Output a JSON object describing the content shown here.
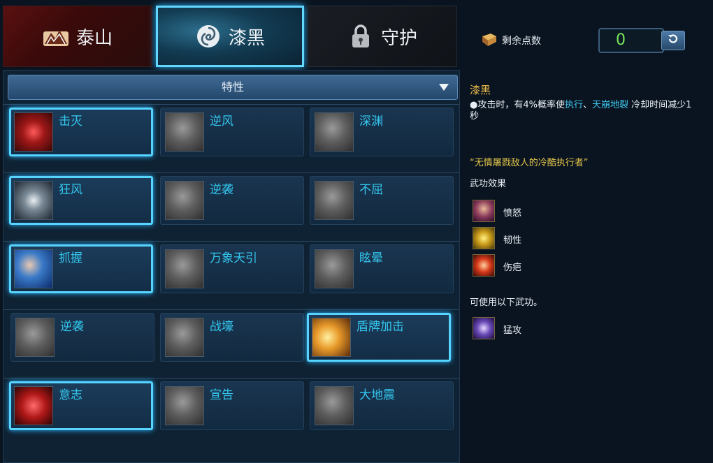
{
  "tabs": [
    {
      "label": "泰山",
      "icon": "mountain-icon"
    },
    {
      "label": "漆黑",
      "icon": "swirl-icon",
      "active": true
    },
    {
      "label": "守护",
      "icon": "lock-icon"
    }
  ],
  "points": {
    "label": "剩余点数",
    "value": "0"
  },
  "dropdown": {
    "label": "特性"
  },
  "rows": [
    [
      {
        "name": "击灭",
        "active": true
      },
      {
        "name": "逆风"
      },
      {
        "name": "深渊"
      }
    ],
    [
      {
        "name": "狂风",
        "active": true
      },
      {
        "name": "逆袭"
      },
      {
        "name": "不屈"
      }
    ],
    [
      {
        "name": "抓握",
        "active": true
      },
      {
        "name": "万象天引"
      },
      {
        "name": "眩晕"
      }
    ],
    [
      {
        "name": "逆袭"
      },
      {
        "name": "战壕"
      },
      {
        "name": "盾牌加击",
        "active": true
      }
    ],
    [
      {
        "name": "意志",
        "active": true
      },
      {
        "name": "宣告"
      },
      {
        "name": "大地震"
      }
    ]
  ],
  "detail": {
    "title": "漆黑",
    "desc_pre": "●攻击时，有4%概率使",
    "desc_hl1": "执行",
    "desc_sep": "、",
    "desc_hl2": "天崩地裂",
    "desc_post": " 冷却时间减少1秒",
    "quote": "“无情屠戮敌人的冷酷执行者”",
    "effects_title": "武功效果",
    "effects": [
      "愤怒",
      "韧性",
      "伤疤"
    ],
    "usable_title": "可使用以下武功。",
    "usable": [
      "猛攻"
    ]
  },
  "colors": {
    "accent": "#56d4ff",
    "skill_name": "#34c8f0",
    "title": "#e6b84a",
    "points": "#78e85a"
  }
}
